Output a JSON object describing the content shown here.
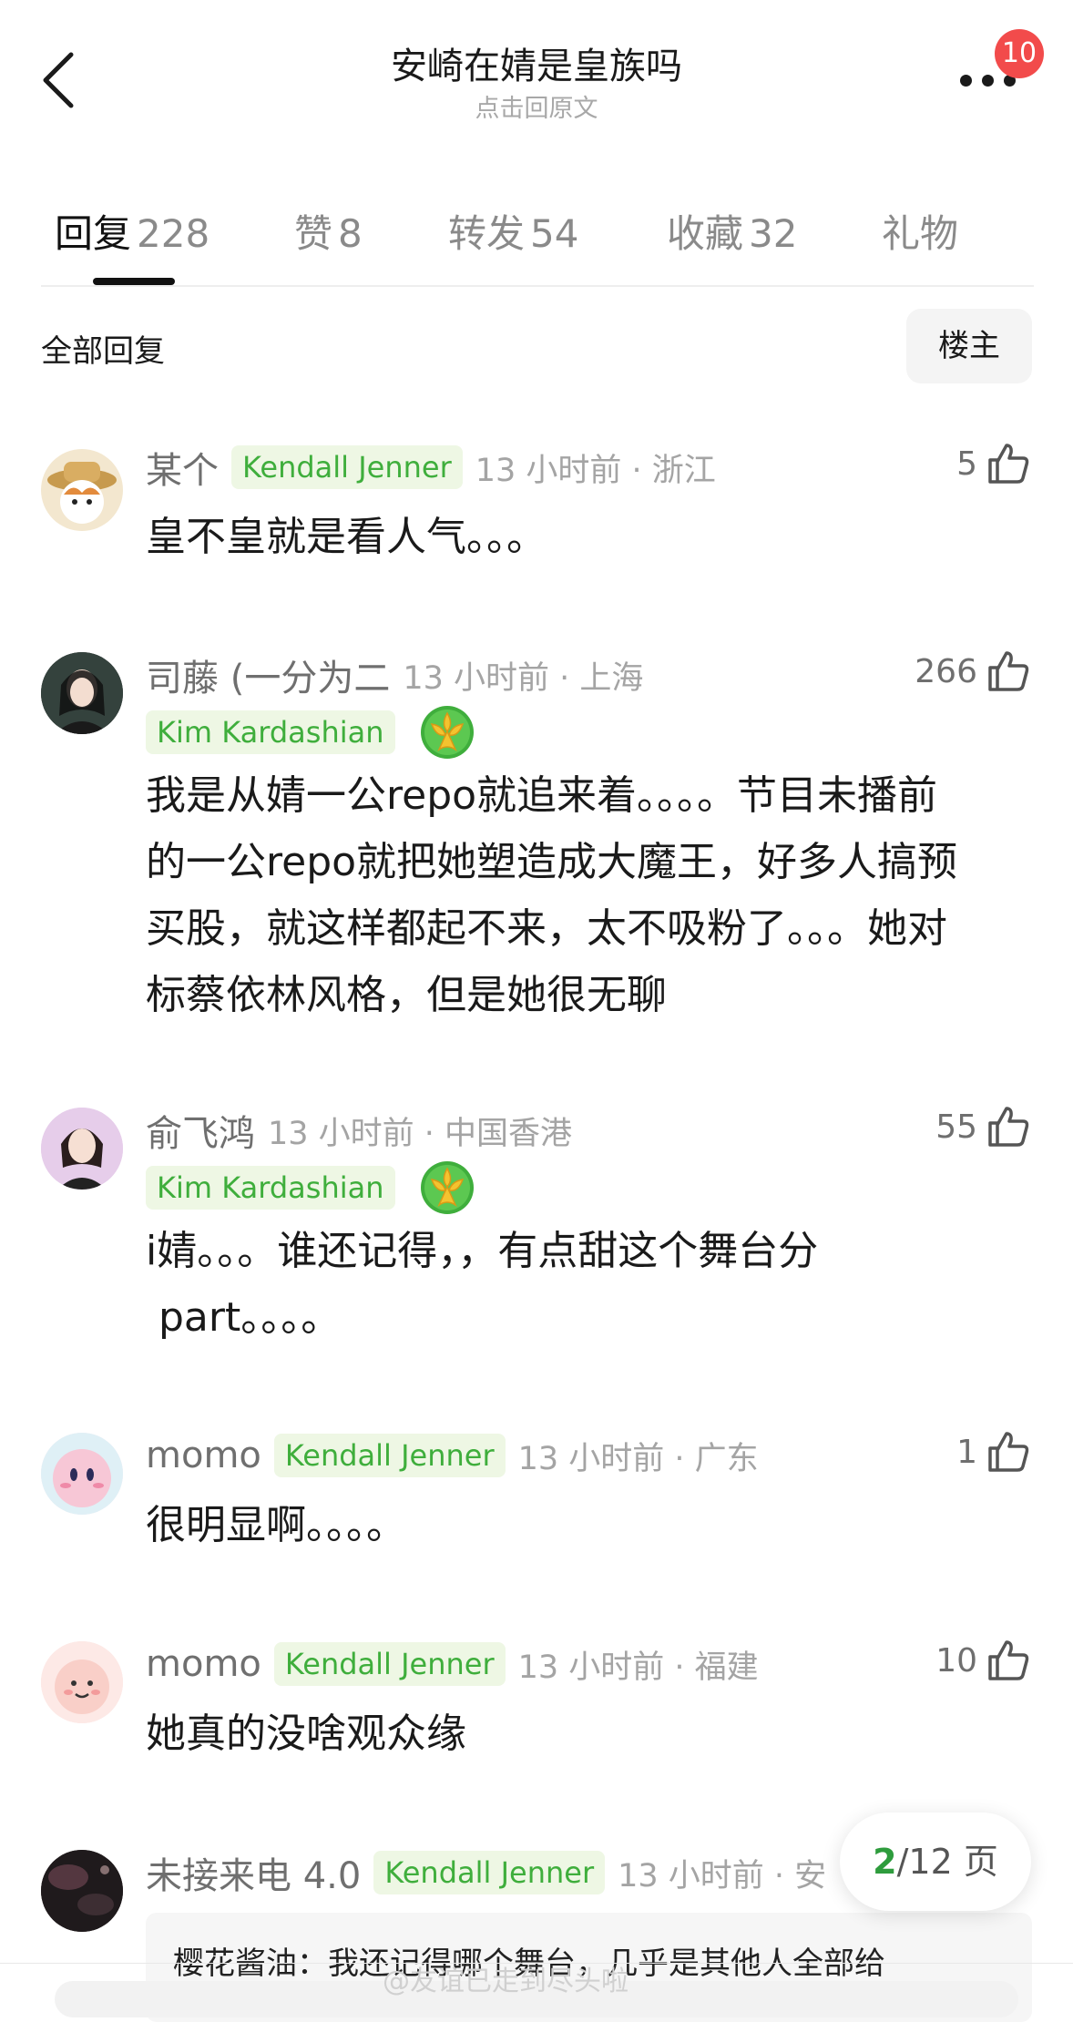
{
  "header": {
    "title": "安崎在婧是皇族吗",
    "subtitle": "点击回原文",
    "badge_count": "10"
  },
  "tabs": [
    {
      "label": "回复",
      "count": "228",
      "active": true
    },
    {
      "label": "赞",
      "count": "8",
      "active": false
    },
    {
      "label": "转发",
      "count": "54",
      "active": false
    },
    {
      "label": "收藏",
      "count": "32",
      "active": false
    },
    {
      "label": "礼物",
      "count": "",
      "active": false
    }
  ],
  "filter": {
    "label": "全部回复",
    "owner_button": "楼主"
  },
  "comments": [
    {
      "username": "某个",
      "tag": "Kendall Jenner",
      "time": "13 小时前 · 浙江",
      "likes": "5",
      "text": "皇不皇就是看人气。。。",
      "medal": false
    },
    {
      "username": "司藤 (一分为二",
      "tag": "Kim Kardashian",
      "time": "13 小时前 · 上海",
      "likes": "266",
      "text": "我是从婧一公repo就追来着。。。。节目未播前\n的一公repo就把她塑造成大魔王，好多人搞预\n买股，就这样都起不来，太不吸粉了。。。她对\n标蔡依林风格，但是她很无聊",
      "medal": true
    },
    {
      "username": "俞飞鸿",
      "tag": "Kim Kardashian",
      "time": "13 小时前 · 中国香港",
      "likes": "55",
      "text": "i婧。。。谁还记得，，有点甜这个舞台分\n part。。。。",
      "medal": true
    },
    {
      "username": "momo",
      "tag": "Kendall Jenner",
      "time": "13 小时前 · 广东",
      "likes": "1",
      "text": "很明显啊。。。。",
      "medal": false
    },
    {
      "username": "momo",
      "tag": "Kendall Jenner",
      "time": "13 小时前 · 福建",
      "likes": "10",
      "text": "她真的没啥观众缘",
      "medal": false
    },
    {
      "username": "未接来电 4.0",
      "tag": "Kendall Jenner",
      "time": "13 小时前 · 安",
      "likes": "",
      "text": "",
      "medal": false
    }
  ],
  "quote": "樱花酱油：我还记得哪个舞台，几乎是其他人全部给",
  "pager": {
    "current": "2",
    "total": "/12 页"
  },
  "watermark": "@友谊已走到尽头啦"
}
